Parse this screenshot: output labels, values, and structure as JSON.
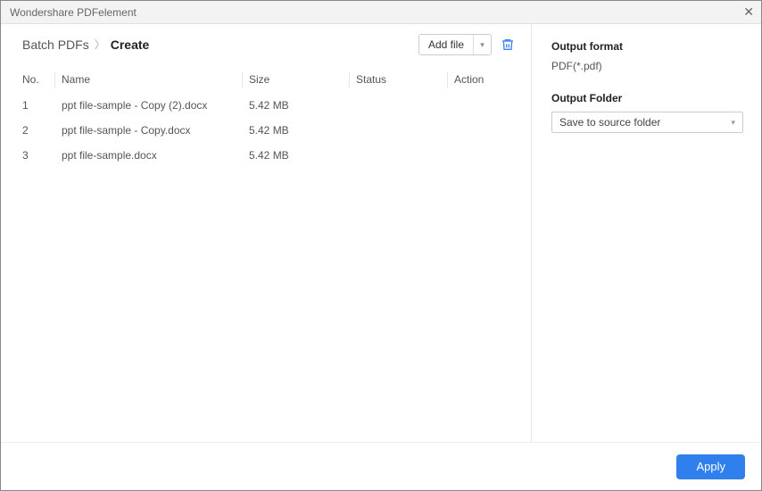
{
  "window": {
    "title": "Wondershare PDFelement"
  },
  "breadcrumb": {
    "parent": "Batch PDFs",
    "current": "Create"
  },
  "toolbar": {
    "add_file_label": "Add file"
  },
  "table": {
    "headers": {
      "no": "No.",
      "name": "Name",
      "size": "Size",
      "status": "Status",
      "action": "Action"
    },
    "rows": [
      {
        "no": "1",
        "name": "ppt file-sample - Copy (2).docx",
        "size": "5.42 MB",
        "status": "",
        "action": ""
      },
      {
        "no": "2",
        "name": "ppt file-sample - Copy.docx",
        "size": "5.42 MB",
        "status": "",
        "action": ""
      },
      {
        "no": "3",
        "name": "ppt file-sample.docx",
        "size": "5.42 MB",
        "status": "",
        "action": ""
      }
    ]
  },
  "right": {
    "output_format_label": "Output format",
    "output_format_value": "PDF(*.pdf)",
    "output_folder_label": "Output Folder",
    "output_folder_value": "Save to source folder"
  },
  "footer": {
    "apply_label": "Apply"
  }
}
